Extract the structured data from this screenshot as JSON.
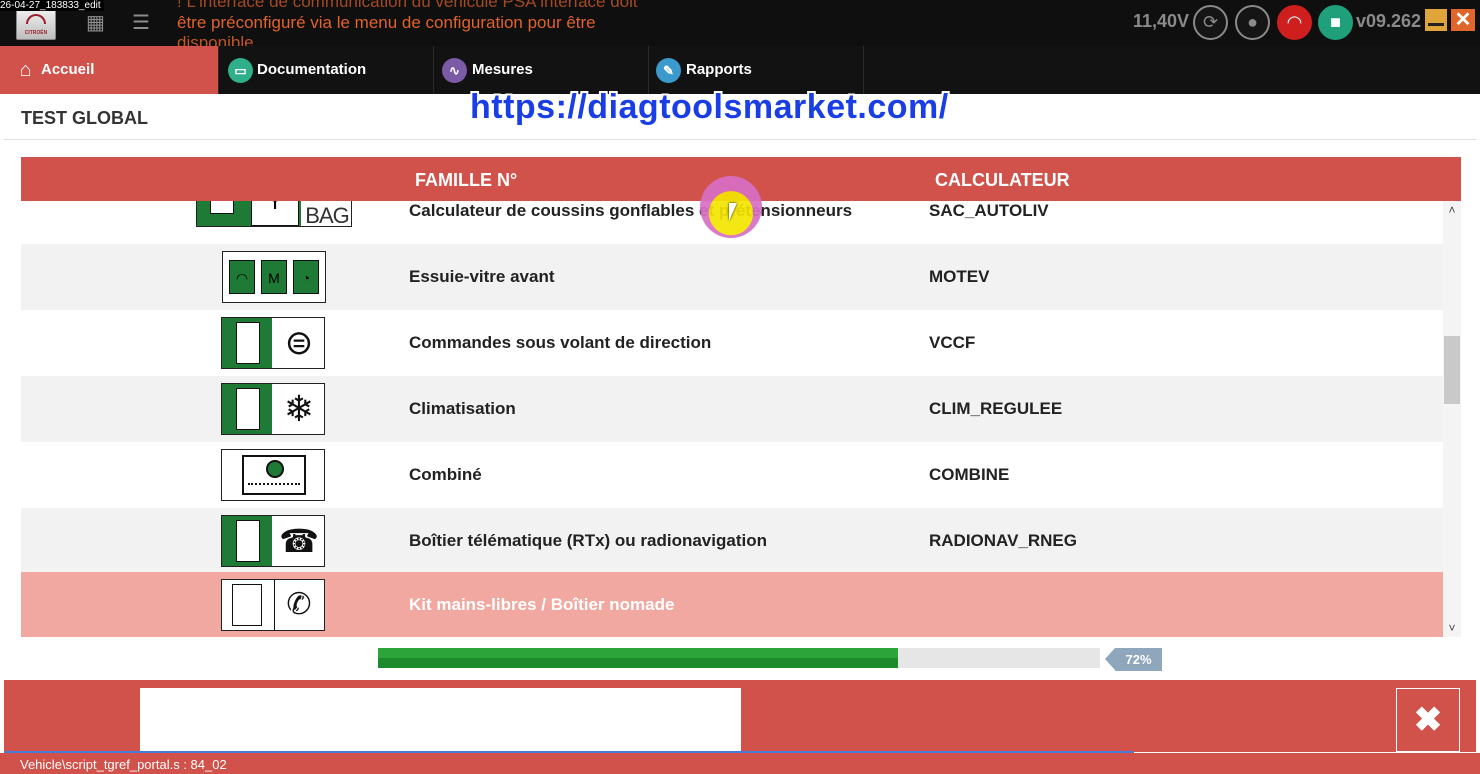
{
  "capture_label": "26-04-27_183833_edit",
  "topbar": {
    "notice_lines": [
      "! L'interface de communication du véhicule PSA interface doit",
      "être préconfiguré via le menu de configuration pour être",
      "disponible"
    ],
    "voltage": "11,40V",
    "version": "v09.262",
    "icons": [
      "grid-icon",
      "list-icon",
      "refresh-icon",
      "user-icon",
      "wifi-icon",
      "lock-icon",
      "minimize-icon",
      "close-icon"
    ],
    "colors": {
      "wifi": "#cf1e1e",
      "lock": "#1fa07a",
      "minimize": "#e0a53a",
      "close": "#e0662c"
    }
  },
  "nav": {
    "tabs": [
      {
        "label": "Accueil",
        "icon": "home-icon",
        "active": true
      },
      {
        "label": "Documentation",
        "icon": "folder-icon",
        "active": false
      },
      {
        "label": "Mesures",
        "icon": "waveform-icon",
        "active": false
      },
      {
        "label": "Rapports",
        "icon": "report-icon",
        "active": false
      }
    ],
    "accent_color": "#d0524a"
  },
  "page": {
    "title": "TEST GLOBAL",
    "watermark": "https://diagtoolsmarket.com/"
  },
  "table": {
    "columns": [
      "FAMILLE N°",
      "CALCULATEUR"
    ],
    "airbag_picto_text": "AIR\nBAG",
    "rows": [
      {
        "famille": "Calculateur de coussins gonflables et prétensionneurs",
        "calculateur": "SAC_AUTOLIV",
        "icon": "airbag-icon"
      },
      {
        "famille": "Essuie-vitre avant",
        "calculateur": "MOTEV",
        "icon": "wiper-icon"
      },
      {
        "famille": "Commandes sous volant de direction",
        "calculateur": "VCCF",
        "icon": "steering-controls-icon"
      },
      {
        "famille": "Climatisation",
        "calculateur": "CLIM_REGULEE",
        "icon": "snowflake-icon"
      },
      {
        "famille": "Combiné",
        "calculateur": "COMBINE",
        "icon": "instrument-cluster-icon"
      },
      {
        "famille": "Boîtier télématique (RTx) ou radionavigation",
        "calculateur": "RADIONAV_RNEG",
        "icon": "telephone-icon"
      },
      {
        "famille": "Kit mains-libres / Boîtier nomade",
        "calculateur": "",
        "icon": "handsfree-icon",
        "selected": true
      }
    ]
  },
  "progress": {
    "value": 0.72,
    "label": "72%",
    "color": "#2ca43a"
  },
  "footer": {
    "close_icon": "close-icon"
  },
  "status_bar": {
    "text": "Vehicle\\script_tgref_portal.s : 84_02"
  }
}
